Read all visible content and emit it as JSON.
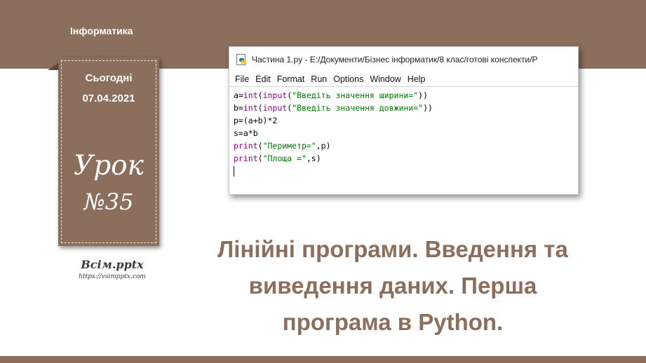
{
  "header": {
    "subject": "Інформатика"
  },
  "date_card": {
    "label": "Сьогодні",
    "date": "07.04.2021",
    "lesson_word": "Урок",
    "lesson_number": "№35"
  },
  "brand": {
    "name": "Всім.pptx",
    "url": "https://vsimpptx.com"
  },
  "ide_window": {
    "title": "Частина 1.py - E:/Документи/Бізнес інформатик/8 клас/готові конспекти/Р",
    "menu": [
      "File",
      "Edit",
      "Format",
      "Run",
      "Options",
      "Window",
      "Help"
    ],
    "code": {
      "line1": {
        "a": "a=",
        "kw1": "int",
        "b": "(",
        "kw2": "input",
        "c": "(",
        "str": "\"Введіть значення ширини=\"",
        "d": "))"
      },
      "line2": {
        "a": "b=",
        "kw1": "int",
        "b": "(",
        "kw2": "input",
        "c": "(",
        "str": "\"Введіть значення довжини=\"",
        "d": "))"
      },
      "line3": "p=(a+b)*2",
      "line4": "s=a*b",
      "line5": {
        "kw": "print",
        "a": "(",
        "str": "\"Периметр=\"",
        "b": ",p)"
      },
      "line6": {
        "kw": "print",
        "a": "(",
        "str": "\"Площа =\"",
        "b": ",s)"
      }
    }
  },
  "title": {
    "line1": "Лінійні програми. Введення та",
    "line2": "виведення даних. Перша",
    "line3": "програма в  Python."
  },
  "colors": {
    "brown": "#8b6e5b",
    "keyword": "#900090",
    "string": "#008000"
  }
}
